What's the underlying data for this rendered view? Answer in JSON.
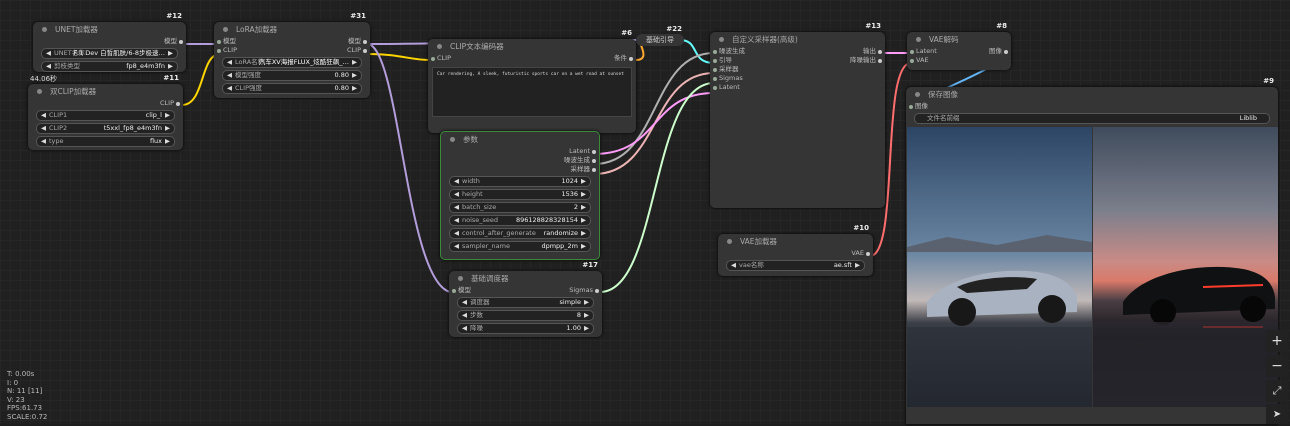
{
  "nodes": {
    "unet": {
      "id": "#12",
      "title": "UNET加载器",
      "output": "模型",
      "widgets": [
        {
          "label": "UNET名称",
          "value": "F:1 Dev 白皙肌肤/6-8步极速…"
        },
        {
          "label": "剪枝类型",
          "value": "fp8_e4m3fn"
        }
      ]
    },
    "dual_clip": {
      "id": "#11",
      "title": "双CLIP加载器",
      "time": "44.06秒",
      "output": "CLIP",
      "widgets": [
        {
          "label": "CLIP1",
          "value": "clip_l"
        },
        {
          "label": "CLIP2",
          "value": "t5xxl_fp8_e4m3fn"
        },
        {
          "label": "type",
          "value": "flux"
        }
      ]
    },
    "lora": {
      "id": "#31",
      "title": "LoRA加载器",
      "inputs": [
        "模型",
        "CLIP"
      ],
      "outputs": [
        "模型",
        "CLIP"
      ],
      "widgets": [
        {
          "label": "LoRA名称",
          "value": "汽车XV海报FLUX_炫酷狂飙_…"
        },
        {
          "label": "模型强度",
          "value": "0.80"
        },
        {
          "label": "CLIP强度",
          "value": "0.80"
        }
      ]
    },
    "clip_text": {
      "id": "#6",
      "title": "CLIP文本编码器",
      "input": "CLIP",
      "output": "条件",
      "text": "Car rendering, A sleek, futuristic sports car on a wet road at sunset"
    },
    "guider": {
      "id": "#22",
      "title": "基础引导"
    },
    "params": {
      "title": "参数",
      "outputs": [
        "Latent",
        "噪波生成",
        "采样器"
      ],
      "widgets": [
        {
          "label": "width",
          "value": "1024"
        },
        {
          "label": "height",
          "value": "1536"
        },
        {
          "label": "batch_size",
          "value": "2"
        },
        {
          "label": "noise_seed",
          "value": "896128828328154"
        },
        {
          "label": "control_after_generate",
          "value": "randomize"
        },
        {
          "label": "sampler_name",
          "value": "dpmpp_2m"
        }
      ]
    },
    "scheduler": {
      "id": "#17",
      "title": "基础调度器",
      "input": "模型",
      "output": "Sigmas",
      "widgets": [
        {
          "label": "调度器",
          "value": "simple"
        },
        {
          "label": "步数",
          "value": "8"
        },
        {
          "label": "降噪",
          "value": "1.00"
        }
      ]
    },
    "sampler": {
      "id": "#13",
      "title": "自定义采样器(高级)",
      "inputs": [
        "噪波生成",
        "引导",
        "采样器",
        "Sigmas",
        "Latent"
      ],
      "outputs": [
        "输出",
        "降噪输出"
      ]
    },
    "vae_decode": {
      "id": "#8",
      "title": "VAE解码",
      "inputs": [
        "Latent",
        "VAE"
      ],
      "output": "图像"
    },
    "vae_loader": {
      "id": "#10",
      "title": "VAE加载器",
      "output": "VAE",
      "widgets": [
        {
          "label": "vae名称",
          "value": "ae.sft"
        }
      ]
    },
    "save": {
      "id": "#9",
      "title": "保存图像",
      "input": "图像",
      "widgets": [
        {
          "label": "文件名前缀",
          "value": "Liblib"
        }
      ]
    }
  },
  "stats": {
    "t": "T: 0.00s",
    "i": "I: 0",
    "n": "N: 11 [11]",
    "v": "V: 23",
    "fps": "FPS:61.73",
    "scale": "SCALE:0.72"
  },
  "controls": {
    "zoom_in": "+",
    "zoom_out": "−",
    "fit": "⤢",
    "pointer": "➤"
  },
  "colors": {
    "model_link": "#b39ddb",
    "clip_link": "#ffd500",
    "cond_link": "#ffa931",
    "latent_link": "#ff9cf9",
    "noise_link": "#b0b0b0",
    "sampler_link": "#ecb4b4",
    "sigmas_link": "#cdffcd",
    "guider_link": "#66ffff",
    "image_link": "#64b5f6",
    "vae_link": "#ff6e6e",
    "params_border": "#3a8a3a"
  }
}
